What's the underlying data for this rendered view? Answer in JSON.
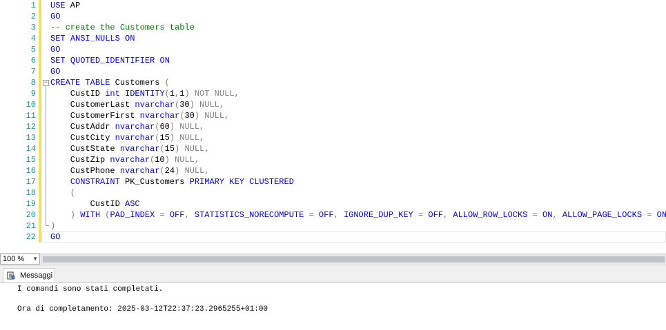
{
  "editor": {
    "line_numbers": [
      "1",
      "2",
      "3",
      "4",
      "5",
      "6",
      "7",
      "8",
      "9",
      "10",
      "11",
      "12",
      "13",
      "14",
      "15",
      "16",
      "17",
      "18",
      "19",
      "20",
      "21",
      "22"
    ],
    "lines": [
      [
        {
          "t": "USE",
          "c": "kw"
        },
        {
          "t": " AP",
          "c": ""
        }
      ],
      [
        {
          "t": "GO",
          "c": "kw"
        }
      ],
      [
        {
          "t": "-- create the Customers table",
          "c": "cm"
        }
      ],
      [
        {
          "t": "SET",
          "c": "kw"
        },
        {
          "t": " ",
          "c": ""
        },
        {
          "t": "ANSI_NULLS",
          "c": "kw"
        },
        {
          "t": " ",
          "c": ""
        },
        {
          "t": "ON",
          "c": "kw"
        }
      ],
      [
        {
          "t": "GO",
          "c": "kw"
        }
      ],
      [
        {
          "t": "SET",
          "c": "kw"
        },
        {
          "t": " ",
          "c": ""
        },
        {
          "t": "QUOTED_IDENTIFIER",
          "c": "kw"
        },
        {
          "t": " ",
          "c": ""
        },
        {
          "t": "ON",
          "c": "kw"
        }
      ],
      [
        {
          "t": "GO",
          "c": "kw"
        }
      ],
      [
        {
          "t": "CREATE",
          "c": "kw"
        },
        {
          "t": " ",
          "c": ""
        },
        {
          "t": "TABLE",
          "c": "kw"
        },
        {
          "t": " Customers ",
          "c": ""
        },
        {
          "t": "(",
          "c": "gr"
        }
      ],
      [
        {
          "t": "    CustID ",
          "c": ""
        },
        {
          "t": "int",
          "c": "kw"
        },
        {
          "t": " ",
          "c": ""
        },
        {
          "t": "IDENTITY",
          "c": "kw"
        },
        {
          "t": "(",
          "c": "gr"
        },
        {
          "t": "1",
          "c": ""
        },
        {
          "t": ",",
          "c": "gr"
        },
        {
          "t": "1",
          "c": ""
        },
        {
          "t": ")",
          "c": "gr"
        },
        {
          "t": " NOT NULL,",
          "c": "gr"
        }
      ],
      [
        {
          "t": "    CustomerLast ",
          "c": ""
        },
        {
          "t": "nvarchar",
          "c": "kw"
        },
        {
          "t": "(",
          "c": "gr"
        },
        {
          "t": "30",
          "c": ""
        },
        {
          "t": ")",
          "c": "gr"
        },
        {
          "t": " NULL,",
          "c": "gr"
        }
      ],
      [
        {
          "t": "    CustomerFirst ",
          "c": ""
        },
        {
          "t": "nvarchar",
          "c": "kw"
        },
        {
          "t": "(",
          "c": "gr"
        },
        {
          "t": "30",
          "c": ""
        },
        {
          "t": ")",
          "c": "gr"
        },
        {
          "t": " NULL,",
          "c": "gr"
        }
      ],
      [
        {
          "t": "    CustAddr ",
          "c": ""
        },
        {
          "t": "nvarchar",
          "c": "kw"
        },
        {
          "t": "(",
          "c": "gr"
        },
        {
          "t": "60",
          "c": ""
        },
        {
          "t": ")",
          "c": "gr"
        },
        {
          "t": " NULL,",
          "c": "gr"
        }
      ],
      [
        {
          "t": "    CustCity ",
          "c": ""
        },
        {
          "t": "nvarchar",
          "c": "kw"
        },
        {
          "t": "(",
          "c": "gr"
        },
        {
          "t": "15",
          "c": ""
        },
        {
          "t": ")",
          "c": "gr"
        },
        {
          "t": " NULL,",
          "c": "gr"
        }
      ],
      [
        {
          "t": "    CustState ",
          "c": ""
        },
        {
          "t": "nvarchar",
          "c": "kw"
        },
        {
          "t": "(",
          "c": "gr"
        },
        {
          "t": "15",
          "c": ""
        },
        {
          "t": ")",
          "c": "gr"
        },
        {
          "t": " NULL,",
          "c": "gr"
        }
      ],
      [
        {
          "t": "    CustZip ",
          "c": ""
        },
        {
          "t": "nvarchar",
          "c": "kw"
        },
        {
          "t": "(",
          "c": "gr"
        },
        {
          "t": "10",
          "c": ""
        },
        {
          "t": ")",
          "c": "gr"
        },
        {
          "t": " NULL,",
          "c": "gr"
        }
      ],
      [
        {
          "t": "    CustPhone ",
          "c": ""
        },
        {
          "t": "nvarchar",
          "c": "kw"
        },
        {
          "t": "(",
          "c": "gr"
        },
        {
          "t": "24",
          "c": ""
        },
        {
          "t": ")",
          "c": "gr"
        },
        {
          "t": " NULL,",
          "c": "gr"
        }
      ],
      [
        {
          "t": "    ",
          "c": ""
        },
        {
          "t": "CONSTRAINT",
          "c": "kw"
        },
        {
          "t": " PK_Customers ",
          "c": ""
        },
        {
          "t": "PRIMARY KEY CLUSTERED",
          "c": "kw"
        }
      ],
      [
        {
          "t": "    (",
          "c": "gr"
        }
      ],
      [
        {
          "t": "        CustID ",
          "c": ""
        },
        {
          "t": "ASC",
          "c": "kw"
        }
      ],
      [
        {
          "t": "    ) ",
          "c": "gr"
        },
        {
          "t": "WITH",
          "c": "kw"
        },
        {
          "t": " (",
          "c": "gr"
        },
        {
          "t": "PAD_INDEX",
          "c": "kw"
        },
        {
          "t": " = ",
          "c": "gr"
        },
        {
          "t": "OFF",
          "c": "kw"
        },
        {
          "t": ", ",
          "c": "gr"
        },
        {
          "t": "STATISTICS_NORECOMPUTE",
          "c": "kw"
        },
        {
          "t": " = ",
          "c": "gr"
        },
        {
          "t": "OFF",
          "c": "kw"
        },
        {
          "t": ", ",
          "c": "gr"
        },
        {
          "t": "IGNORE_DUP_KEY",
          "c": "kw"
        },
        {
          "t": " = ",
          "c": "gr"
        },
        {
          "t": "OFF",
          "c": "kw"
        },
        {
          "t": ", ",
          "c": "gr"
        },
        {
          "t": "ALLOW_ROW_LOCKS",
          "c": "kw"
        },
        {
          "t": " = ",
          "c": "gr"
        },
        {
          "t": "ON",
          "c": "kw"
        },
        {
          "t": ", ",
          "c": "gr"
        },
        {
          "t": "ALLOW_PAGE_LOCKS",
          "c": "kw"
        },
        {
          "t": " = ",
          "c": "gr"
        },
        {
          "t": "ON",
          "c": "kw"
        },
        {
          "t": ")",
          "c": "gr"
        }
      ],
      [
        {
          "t": ")",
          "c": "gr"
        }
      ],
      [
        {
          "t": "GO",
          "c": "kw"
        }
      ]
    ]
  },
  "zoom": {
    "value": "100 %"
  },
  "results": {
    "tab_label": "Messaggi",
    "messages": [
      "I comandi sono stati completati.",
      "Ora di completamento: 2025-03-12T22:37:23.2965255+01:00"
    ]
  },
  "colors": {
    "keyword": "#0000ff",
    "comment": "#008000",
    "operator": "#808080",
    "line_number": "#2b91af",
    "change_bar": "#f0e060"
  }
}
